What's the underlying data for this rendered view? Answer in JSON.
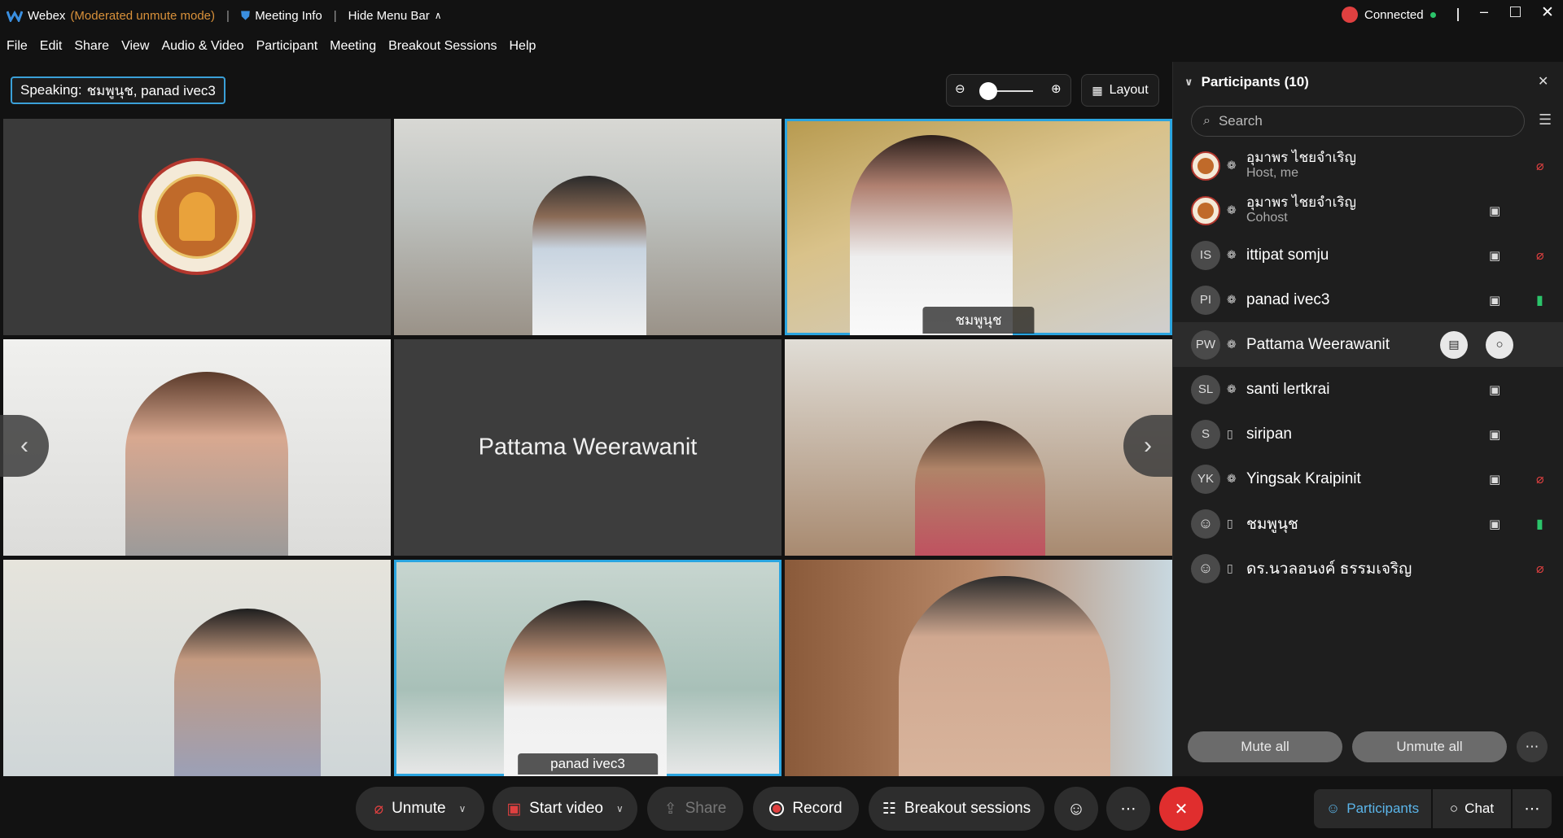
{
  "titlebar": {
    "app_name": "Webex",
    "mode": "(Moderated unmute mode)",
    "meeting_info": "Meeting Info",
    "hide_menu": "Hide Menu Bar",
    "connection_status": "Connected"
  },
  "menubar": [
    "File",
    "Edit",
    "Share",
    "View",
    "Audio & Video",
    "Participant",
    "Meeting",
    "Breakout Sessions",
    "Help"
  ],
  "speaking": {
    "label": "Speaking:",
    "names": "ชมพูนุช, panad ivec3"
  },
  "toolbar": {
    "layout_label": "Layout"
  },
  "video_tiles": [
    {
      "name": "",
      "type": "logo"
    },
    {
      "name": "",
      "type": "video"
    },
    {
      "name": "ชมพูนุช",
      "type": "video",
      "active": true
    },
    {
      "name": "",
      "type": "video"
    },
    {
      "name": "Pattama Weerawanit",
      "type": "name-only"
    },
    {
      "name": "",
      "type": "video"
    },
    {
      "name": "",
      "type": "video"
    },
    {
      "name": "panad ivec3",
      "type": "video",
      "active": true
    },
    {
      "name": "",
      "type": "video"
    }
  ],
  "participants_panel": {
    "title": "Participants (10)",
    "search_placeholder": "Search",
    "participants": [
      {
        "initials": "",
        "name": "อุมาพร ไชยจำเริญ",
        "role": "Host, me",
        "mic": "muted",
        "camera": false
      },
      {
        "initials": "",
        "name": "อุมาพร ไชยจำเริญ",
        "role": "Cohost",
        "mic": "",
        "camera": true
      },
      {
        "initials": "IS",
        "name": "ittipat somju",
        "role": "",
        "mic": "muted",
        "camera": true
      },
      {
        "initials": "PI",
        "name": "panad ivec3",
        "role": "",
        "mic": "active",
        "camera": true
      },
      {
        "initials": "PW",
        "name": "Pattama Weerawanit",
        "role": "",
        "mic": "",
        "camera": false
      },
      {
        "initials": "SL",
        "name": "santi lertkrai",
        "role": "",
        "mic": "",
        "camera": true
      },
      {
        "initials": "S",
        "name": "siripan",
        "role": "",
        "mic": "",
        "camera": true
      },
      {
        "initials": "YK",
        "name": "Yingsak Kraipinit",
        "role": "",
        "mic": "muted",
        "camera": true
      },
      {
        "initials": "",
        "name": "ชมพูนุช",
        "role": "",
        "mic": "active",
        "camera": true
      },
      {
        "initials": "",
        "name": "ดร.นวลอนงค์ ธรรมเจริญ",
        "role": "",
        "mic": "muted",
        "camera": false
      }
    ],
    "mute_all": "Mute all",
    "unmute_all": "Unmute all"
  },
  "controls": {
    "unmute": "Unmute",
    "start_video": "Start video",
    "share": "Share",
    "record": "Record",
    "breakout": "Breakout sessions",
    "participants": "Participants",
    "chat": "Chat"
  },
  "colors": {
    "accent_blue": "#2ba5e0",
    "end_red": "#e02e2e",
    "mute_red": "#e04040",
    "mic_green": "#2bc46a",
    "mode_orange": "#d9913a"
  }
}
